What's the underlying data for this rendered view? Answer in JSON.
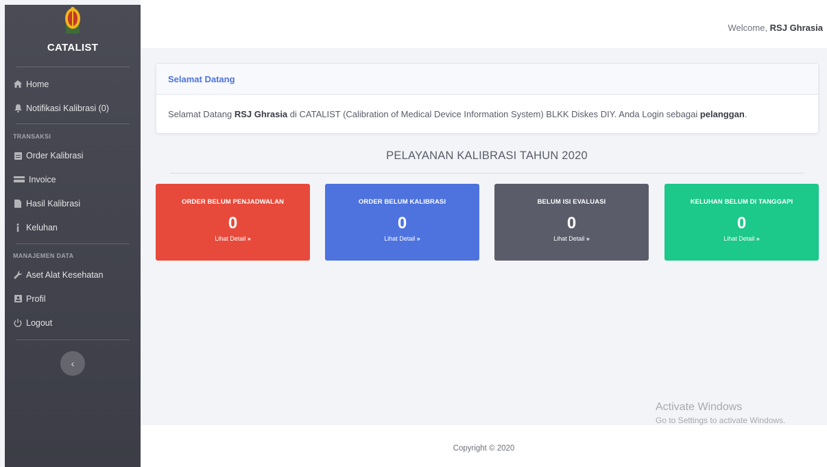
{
  "brand": {
    "name": "CATALIST"
  },
  "sidebar": {
    "items_top": [
      {
        "label": "Home",
        "icon": "home-icon"
      },
      {
        "label": "Notifikasi Kalibrasi (0)",
        "icon": "bell-icon"
      }
    ],
    "section_transaksi": "TRANSAKSI",
    "items_transaksi": [
      {
        "label": "Order Kalibrasi",
        "icon": "clipboard-icon"
      },
      {
        "label": "Invoice",
        "icon": "invoice-icon"
      },
      {
        "label": "Hasil Kalibrasi",
        "icon": "file-icon"
      },
      {
        "label": "Keluhan",
        "icon": "info-icon"
      }
    ],
    "section_manajemen": "MANAJEMEN DATA",
    "items_manajemen": [
      {
        "label": "Aset Alat Kesehatan",
        "icon": "wrench-icon"
      },
      {
        "label": "Profil",
        "icon": "id-card-icon"
      },
      {
        "label": "Logout",
        "icon": "power-icon"
      }
    ],
    "toggle_icon": "‹"
  },
  "topbar": {
    "welcome_prefix": "Welcome, ",
    "user": "RSJ Ghrasia"
  },
  "welcome_card": {
    "header": "Selamat Datang",
    "text_1": "Selamat Datang ",
    "user": "RSJ Ghrasia",
    "text_2": " di CATALIST (Calibration of Medical Device Information System) BLKK Diskes DIY. Anda Login sebagai ",
    "role": "pelanggan",
    "text_3": "."
  },
  "page_title": "PELAYANAN KALIBRASI TAHUN 2020",
  "stats": [
    {
      "label": "ORDER BELUM PENJADWALAN",
      "value": "0",
      "link": "Lihat Detail",
      "color": "#e74a3b"
    },
    {
      "label": "ORDER BELUM KALIBRASI",
      "value": "0",
      "link": "Lihat Detail",
      "color": "#4e73df"
    },
    {
      "label": "BELUM ISI EVALUASI",
      "value": "0",
      "link": "Lihat Detail",
      "color": "#5a5c69"
    },
    {
      "label": "KELUHAN BELUM DI TANGGAPI",
      "value": "0",
      "link": "Lihat Detail",
      "color": "#1cc88a"
    }
  ],
  "watermark": {
    "line1": "Activate Windows",
    "line2": "Go to Settings to activate Windows."
  },
  "footer": {
    "text": "Copyright © 2020"
  }
}
